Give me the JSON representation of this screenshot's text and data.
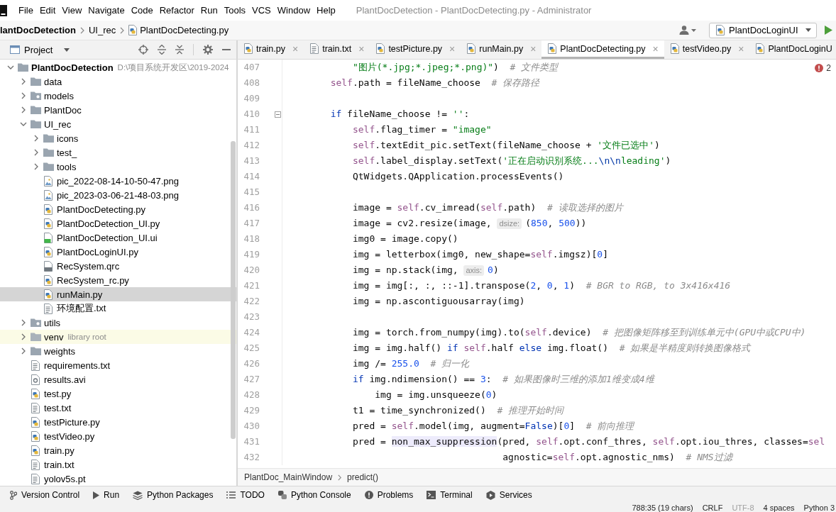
{
  "menu_bar": {
    "items": [
      "File",
      "Edit",
      "View",
      "Navigate",
      "Code",
      "Refactor",
      "Run",
      "Tools",
      "VCS",
      "Window",
      "Help"
    ],
    "title": "PlantDocDetection - PlantDocDetecting.py - Administrator"
  },
  "navigation_bar": {
    "breadcrumbs": [
      {
        "label": "lantDocDetection",
        "kind": "project"
      },
      {
        "label": "UI_rec",
        "kind": "folder"
      },
      {
        "label": "PlantDocDetecting.py",
        "kind": "python"
      }
    ],
    "run_configuration": "PlantDocLoginUI"
  },
  "project_panel": {
    "title": "Project",
    "tree": [
      {
        "name": "PlantDocDetection",
        "kind": "project",
        "note": "D:\\项目系统开发区\\2019-2024",
        "expanded": true,
        "selected": false,
        "children": [
          {
            "name": "data",
            "kind": "folder",
            "expanded": false,
            "selected": false
          },
          {
            "name": "models",
            "kind": "package",
            "expanded": false,
            "selected": false
          },
          {
            "name": "PlantDoc",
            "kind": "folder",
            "expanded": false,
            "selected": false
          },
          {
            "name": "UI_rec",
            "kind": "folder",
            "expanded": true,
            "selected": false,
            "children": [
              {
                "name": "icons",
                "kind": "folder",
                "expanded": false,
                "selected": false
              },
              {
                "name": "test_",
                "kind": "folder",
                "expanded": false,
                "selected": false
              },
              {
                "name": "tools",
                "kind": "folder",
                "expanded": false,
                "selected": false
              },
              {
                "name": "pic_2022-08-14-10-50-47.png",
                "kind": "image",
                "selected": false
              },
              {
                "name": "pic_2023-03-06-21-48-03.png",
                "kind": "image",
                "selected": false
              },
              {
                "name": "PlantDocDetecting.py",
                "kind": "python",
                "selected": false
              },
              {
                "name": "PlantDocDetection_UI.py",
                "kind": "python",
                "selected": false
              },
              {
                "name": "PlantDocDetection_UI.ui",
                "kind": "qt",
                "selected": false
              },
              {
                "name": "PlantDocLoginUI.py",
                "kind": "python",
                "selected": false
              },
              {
                "name": "RecSystem.qrc",
                "kind": "qrc",
                "selected": false
              },
              {
                "name": "RecSystem_rc.py",
                "kind": "python",
                "selected": false
              },
              {
                "name": "runMain.py",
                "kind": "python",
                "selected": true
              },
              {
                "name": "环境配置.txt",
                "kind": "text",
                "selected": false
              }
            ]
          },
          {
            "name": "utils",
            "kind": "package",
            "expanded": false,
            "selected": false
          },
          {
            "name": "venv",
            "kind": "library",
            "note": "library root",
            "expanded": false,
            "selected": false
          },
          {
            "name": "weights",
            "kind": "folder",
            "expanded": false,
            "selected": false
          },
          {
            "name": "requirements.txt",
            "kind": "text",
            "selected": false
          },
          {
            "name": "results.avi",
            "kind": "unknown",
            "selected": false
          },
          {
            "name": "test.py",
            "kind": "python",
            "selected": false
          },
          {
            "name": "test.txt",
            "kind": "text",
            "selected": false
          },
          {
            "name": "testPicture.py",
            "kind": "python",
            "selected": false
          },
          {
            "name": "testVideo.py",
            "kind": "python",
            "selected": false
          },
          {
            "name": "train.py",
            "kind": "python",
            "selected": false
          },
          {
            "name": "train.txt",
            "kind": "text",
            "selected": false
          },
          {
            "name": "yolov5s.pt",
            "kind": "text",
            "selected": false
          }
        ]
      }
    ]
  },
  "editor": {
    "tabs": [
      {
        "label": "train.py",
        "kind": "python",
        "selected": false,
        "close": "×"
      },
      {
        "label": "train.txt",
        "kind": "text",
        "selected": false,
        "close": "×"
      },
      {
        "label": "testPicture.py",
        "kind": "python",
        "selected": false,
        "close": "×"
      },
      {
        "label": "runMain.py",
        "kind": "python",
        "selected": false,
        "close": "×"
      },
      {
        "label": "PlantDocDetecting.py",
        "kind": "python",
        "selected": true,
        "close": "×"
      },
      {
        "label": "testVideo.py",
        "kind": "python",
        "selected": false,
        "close": "×"
      },
      {
        "label": "PlantDocLoginU",
        "kind": "python",
        "selected": false
      }
    ],
    "error_count": "2",
    "lines": [
      {
        "number": "407",
        "fold": false,
        "tokens": [
          {
            "kind": "string",
            "text": "            \"图片(*.jpg;*.jpeg;*.png)\""
          },
          {
            "kind": "plain",
            "text": ")  "
          },
          {
            "kind": "comment",
            "text": "# 文件类型"
          }
        ]
      },
      {
        "number": "408",
        "fold": false,
        "tokens": [
          {
            "kind": "self",
            "text": "        self"
          },
          {
            "kind": "plain",
            "text": ".path = fileName_choose  "
          },
          {
            "kind": "comment",
            "text": "# 保存路径"
          }
        ]
      },
      {
        "number": "409",
        "fold": false
      },
      {
        "number": "410",
        "fold": true,
        "tokens": [
          {
            "kind": "keyword",
            "text": "        if"
          },
          {
            "kind": "plain",
            "text": " fileName_choose != "
          },
          {
            "kind": "string",
            "text": "''"
          },
          {
            "kind": "plain",
            "text": ":"
          }
        ]
      },
      {
        "number": "411",
        "fold": false,
        "tokens": [
          {
            "kind": "self",
            "text": "            self"
          },
          {
            "kind": "plain",
            "text": ".flag_timer = "
          },
          {
            "kind": "string",
            "text": "\"image\""
          }
        ]
      },
      {
        "number": "412",
        "fold": false,
        "tokens": [
          {
            "kind": "self",
            "text": "            self"
          },
          {
            "kind": "plain",
            "text": ".textEdit_pic.setText(fileName_choose + "
          },
          {
            "kind": "string",
            "text": "'文件已选中'"
          },
          {
            "kind": "plain",
            "text": ")"
          }
        ]
      },
      {
        "number": "413",
        "fold": false,
        "tokens": [
          {
            "kind": "self",
            "text": "            self"
          },
          {
            "kind": "plain",
            "text": ".label_display.setText("
          },
          {
            "kind": "string",
            "text": "'正在启动识别系统..."
          },
          {
            "kind": "escape",
            "text": "\\n\\n"
          },
          {
            "kind": "string",
            "text": "leading'"
          },
          {
            "kind": "plain",
            "text": ")"
          }
        ]
      },
      {
        "number": "414",
        "fold": false,
        "tokens": [
          {
            "kind": "plain",
            "text": "            QtWidgets.QApplication.processEvents()"
          }
        ]
      },
      {
        "number": "415",
        "fold": false
      },
      {
        "number": "416",
        "fold": false,
        "tokens": [
          {
            "kind": "plain",
            "text": "            image = "
          },
          {
            "kind": "self",
            "text": "self"
          },
          {
            "kind": "plain",
            "text": ".cv_imread("
          },
          {
            "kind": "self",
            "text": "self"
          },
          {
            "kind": "plain",
            "text": ".path)  "
          },
          {
            "kind": "comment",
            "text": "# 读取选择的图片"
          }
        ]
      },
      {
        "number": "417",
        "fold": false,
        "tokens": [
          {
            "kind": "plain",
            "text": "            image = cv2.resize(image, "
          },
          {
            "kind": "hint",
            "text": "dsize:"
          },
          {
            "kind": "plain",
            "text": "("
          },
          {
            "kind": "number",
            "text": "850"
          },
          {
            "kind": "plain",
            "text": ", "
          },
          {
            "kind": "number",
            "text": "500"
          },
          {
            "kind": "plain",
            "text": "))"
          }
        ]
      },
      {
        "number": "418",
        "fold": false,
        "tokens": [
          {
            "kind": "plain",
            "text": "            img0 = image.copy()"
          }
        ]
      },
      {
        "number": "419",
        "fold": false,
        "tokens": [
          {
            "kind": "plain",
            "text": "            img = letterbox(img0, new_shape="
          },
          {
            "kind": "self",
            "text": "self"
          },
          {
            "kind": "plain",
            "text": ".imgsz)["
          },
          {
            "kind": "number",
            "text": "0"
          },
          {
            "kind": "plain",
            "text": "]"
          }
        ]
      },
      {
        "number": "420",
        "fold": false,
        "tokens": [
          {
            "kind": "plain",
            "text": "            img = np.stack(img, "
          },
          {
            "kind": "hint",
            "text": "axis:"
          },
          {
            "kind": "number",
            "text": "0"
          },
          {
            "kind": "plain",
            "text": ")"
          }
        ]
      },
      {
        "number": "421",
        "fold": false,
        "tokens": [
          {
            "kind": "plain",
            "text": "            img = img[:, :, ::-1].transpose("
          },
          {
            "kind": "number",
            "text": "2"
          },
          {
            "kind": "plain",
            "text": ", "
          },
          {
            "kind": "number",
            "text": "0"
          },
          {
            "kind": "plain",
            "text": ", "
          },
          {
            "kind": "number",
            "text": "1"
          },
          {
            "kind": "plain",
            "text": ")  "
          },
          {
            "kind": "comment",
            "text": "# BGR to RGB, to 3x416x416"
          }
        ]
      },
      {
        "number": "422",
        "fold": false,
        "tokens": [
          {
            "kind": "plain",
            "text": "            img = np.ascontiguousarray(img)"
          }
        ]
      },
      {
        "number": "423",
        "fold": false
      },
      {
        "number": "424",
        "fold": false,
        "tokens": [
          {
            "kind": "plain",
            "text": "            img = torch.from_numpy(img).to("
          },
          {
            "kind": "self",
            "text": "self"
          },
          {
            "kind": "plain",
            "text": ".device)  "
          },
          {
            "kind": "comment",
            "text": "# 把图像矩阵移至到训练单元中(GPU中或CPU中)"
          }
        ]
      },
      {
        "number": "425",
        "fold": false,
        "tokens": [
          {
            "kind": "plain",
            "text": "            img = img.half() "
          },
          {
            "kind": "keyword",
            "text": "if "
          },
          {
            "kind": "self",
            "text": "self"
          },
          {
            "kind": "plain",
            "text": ".half "
          },
          {
            "kind": "keyword",
            "text": "else"
          },
          {
            "kind": "plain",
            "text": " img.float()  "
          },
          {
            "kind": "comment",
            "text": "# 如果是半精度则转换图像格式"
          }
        ]
      },
      {
        "number": "426",
        "fold": false,
        "tokens": [
          {
            "kind": "plain",
            "text": "            img /= "
          },
          {
            "kind": "number",
            "text": "255.0"
          },
          {
            "kind": "comment",
            "text": "  # 归一化"
          }
        ]
      },
      {
        "number": "427",
        "fold": false,
        "tokens": [
          {
            "kind": "keyword",
            "text": "            if"
          },
          {
            "kind": "plain",
            "text": " img.ndimension() == "
          },
          {
            "kind": "number",
            "text": "3"
          },
          {
            "kind": "plain",
            "text": ":  "
          },
          {
            "kind": "comment",
            "text": "# 如果图像时三维的添加1维变成4维"
          }
        ]
      },
      {
        "number": "428",
        "fold": false,
        "tokens": [
          {
            "kind": "plain",
            "text": "                img = img.unsqueeze("
          },
          {
            "kind": "number",
            "text": "0"
          },
          {
            "kind": "plain",
            "text": ")"
          }
        ]
      },
      {
        "number": "429",
        "fold": false,
        "tokens": [
          {
            "kind": "plain",
            "text": "            t1 = time_synchronized()  "
          },
          {
            "kind": "comment",
            "text": "# 推理开始时间"
          }
        ]
      },
      {
        "number": "430",
        "fold": false,
        "tokens": [
          {
            "kind": "plain",
            "text": "            pred = "
          },
          {
            "kind": "self",
            "text": "self"
          },
          {
            "kind": "plain",
            "text": ".model(img, augment="
          },
          {
            "kind": "keyword",
            "text": "False"
          },
          {
            "kind": "plain",
            "text": ")["
          },
          {
            "kind": "number",
            "text": "0"
          },
          {
            "kind": "plain",
            "text": "]  "
          },
          {
            "kind": "comment",
            "text": "# 前向推理"
          }
        ]
      },
      {
        "number": "431",
        "fold": false,
        "tokens": [
          {
            "kind": "plain",
            "text": "            pred = "
          },
          {
            "kind": "usage",
            "text": "non_max_suppression"
          },
          {
            "kind": "plain",
            "text": "(pred, "
          },
          {
            "kind": "self",
            "text": "self"
          },
          {
            "kind": "plain",
            "text": ".opt.conf_thres, "
          },
          {
            "kind": "self",
            "text": "self"
          },
          {
            "kind": "plain",
            "text": ".opt.iou_thres, classes="
          },
          {
            "kind": "self",
            "text": "sel"
          }
        ]
      },
      {
        "number": "432",
        "fold": false,
        "tokens": [
          {
            "kind": "plain",
            "text": "                                       agnostic="
          },
          {
            "kind": "self",
            "text": "self"
          },
          {
            "kind": "plain",
            "text": ".opt.agnostic_nms)  "
          },
          {
            "kind": "comment",
            "text": "# NMS过滤"
          }
        ]
      }
    ],
    "breadcrumbs": [
      "PlantDoc_MainWindow",
      "predict()"
    ]
  },
  "tool_window_bar": [
    {
      "label": "Version Control",
      "kind": "vcs"
    },
    {
      "label": "Run",
      "kind": "run"
    },
    {
      "label": "Python Packages",
      "kind": "packages"
    },
    {
      "label": "TODO",
      "kind": "todo"
    },
    {
      "label": "Python Console",
      "kind": "console"
    },
    {
      "label": "Problems",
      "kind": "problems"
    },
    {
      "label": "Terminal",
      "kind": "terminal"
    },
    {
      "label": "Services",
      "kind": "services"
    }
  ],
  "status_bar": [
    {
      "text": "788:35 (19 chars)",
      "disabled": false
    },
    {
      "text": "CRLF",
      "disabled": false
    },
    {
      "text": "UTF-8",
      "disabled": true
    },
    {
      "text": "4 spaces",
      "disabled": false
    },
    {
      "text": "Python 3",
      "disabled": false
    }
  ]
}
